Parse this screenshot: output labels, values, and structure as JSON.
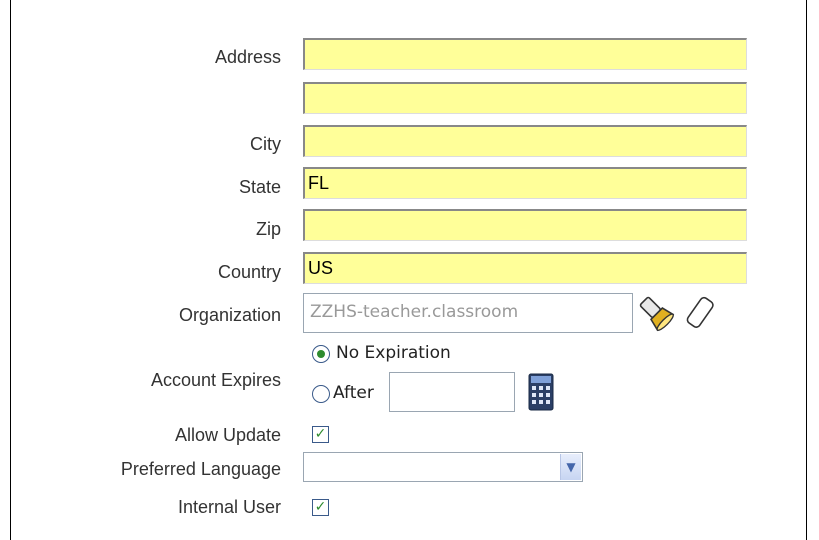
{
  "form": {
    "address": {
      "label": "Address",
      "value": "",
      "value2": ""
    },
    "city": {
      "label": "City",
      "value": ""
    },
    "state": {
      "label": "State",
      "value": "FL"
    },
    "zip": {
      "label": "Zip",
      "value": ""
    },
    "country": {
      "label": "Country",
      "value": "US"
    },
    "organization": {
      "label": "Organization",
      "value": "ZZHS-teacher.classroom"
    },
    "account_expires": {
      "label": "Account Expires",
      "option_no_expiration": "No Expiration",
      "option_after": "After",
      "selected": "No Expiration",
      "after_value": ""
    },
    "allow_update": {
      "label": "Allow Update",
      "checked": true
    },
    "preferred_language": {
      "label": "Preferred Language",
      "value": ""
    },
    "internal_user": {
      "label": "Internal User",
      "checked": true
    }
  },
  "icons": {
    "org_lookup": "flashlight-icon",
    "org_clear": "eraser-icon",
    "calendar": "calendar-icon",
    "dropdown": "chevron-down-icon",
    "checkmark": "✓"
  },
  "colors": {
    "required_field_bg": "#ffff99",
    "checkmark": "#2e8b2e",
    "radio_dot": "#2e8b2e",
    "label_text": "#333333"
  }
}
